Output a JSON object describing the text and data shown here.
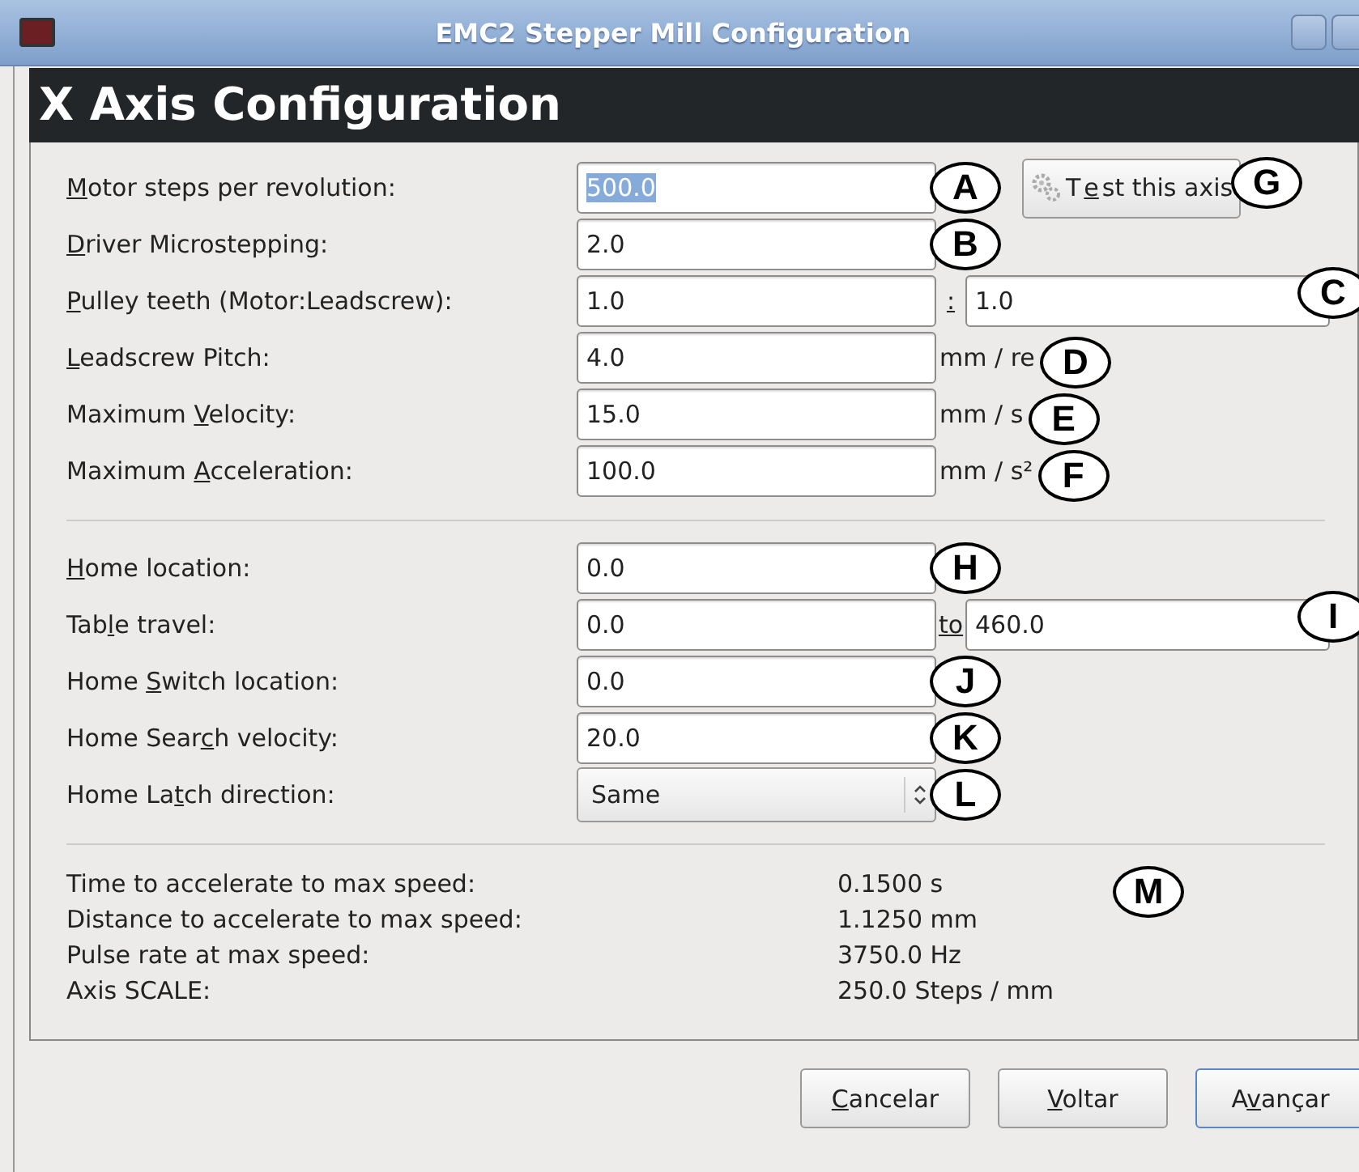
{
  "window": {
    "title": "EMC2 Stepper Mill Configuration"
  },
  "header": "X Axis Configuration",
  "sections": [
    {
      "rows": [
        {
          "kind": "entry",
          "label": {
            "key": "M",
            "post": "otor steps per revolution:"
          },
          "value": "500.0",
          "text_selected": true,
          "callout": "A",
          "button": {
            "pre": "T",
            "key": "e",
            "post": "st this axis"
          },
          "button_callout": "G"
        },
        {
          "kind": "entry",
          "label": {
            "key": "D",
            "post": "river Microstepping:"
          },
          "value": "2.0",
          "text_selected": false,
          "callout": "B"
        },
        {
          "kind": "pair",
          "label": {
            "key": "P",
            "post": "ulley teeth (Motor:Leadscrew):"
          },
          "value": "1.0",
          "text_selected": false,
          "separator": ":",
          "value2": "1.0",
          "callout": "C"
        },
        {
          "kind": "unit",
          "label": {
            "key": "L",
            "post": "eadscrew Pitch:"
          },
          "value": "4.0",
          "text_selected": false,
          "unit": "mm / re",
          "callout": "D"
        },
        {
          "kind": "unit",
          "label": {
            "pre": "Maximum ",
            "key": "V",
            "post": "elocity:"
          },
          "value": "15.0",
          "text_selected": false,
          "unit": "mm / s",
          "callout": "E"
        },
        {
          "kind": "unit",
          "label": {
            "pre": "Maximum ",
            "key": "A",
            "post": "cceleration:"
          },
          "value": "100.0",
          "text_selected": false,
          "unit": "mm / s²",
          "callout": "F"
        }
      ]
    },
    {
      "rows": [
        {
          "kind": "entry",
          "label": {
            "key": "H",
            "post": "ome location:"
          },
          "value": "0.0",
          "text_selected": false,
          "callout": "H"
        },
        {
          "kind": "pair",
          "label": {
            "pre": "Tab",
            "key": "l",
            "post": "e travel:"
          },
          "value": "0.0",
          "text_selected": false,
          "separator": "to",
          "value2": "460.0",
          "callout": "I"
        },
        {
          "kind": "entry",
          "label": {
            "pre": "Home ",
            "key": "S",
            "post": "witch location:"
          },
          "value": "0.0",
          "text_selected": false,
          "callout": "J"
        },
        {
          "kind": "entry",
          "label": {
            "pre": "Home Sear",
            "key": "c",
            "post": "h velocity:"
          },
          "value": "20.0",
          "text_selected": false,
          "callout": "K"
        },
        {
          "kind": "combo",
          "label": {
            "pre": "Home La",
            "key": "t",
            "post": "ch direction:"
          },
          "value": "Same",
          "callout": "L"
        }
      ]
    }
  ],
  "info": {
    "lines": [
      {
        "label": "Time to accelerate to max speed:",
        "value": "0.1500 s"
      },
      {
        "label": "Distance to accelerate to max speed:",
        "value": "1.1250 mm"
      },
      {
        "label": "Pulse rate at max speed:",
        "value": "3750.0 Hz"
      },
      {
        "label": "Axis SCALE:",
        "value": "250.0 Steps / mm"
      }
    ],
    "callout": "M"
  },
  "buttons": [
    {
      "key": "C",
      "post": "ancelar",
      "focused": false
    },
    {
      "key": "V",
      "post": "oltar",
      "focused": false
    },
    {
      "pre": "A",
      "key": "v",
      "post": "ançar",
      "focused": true
    }
  ]
}
